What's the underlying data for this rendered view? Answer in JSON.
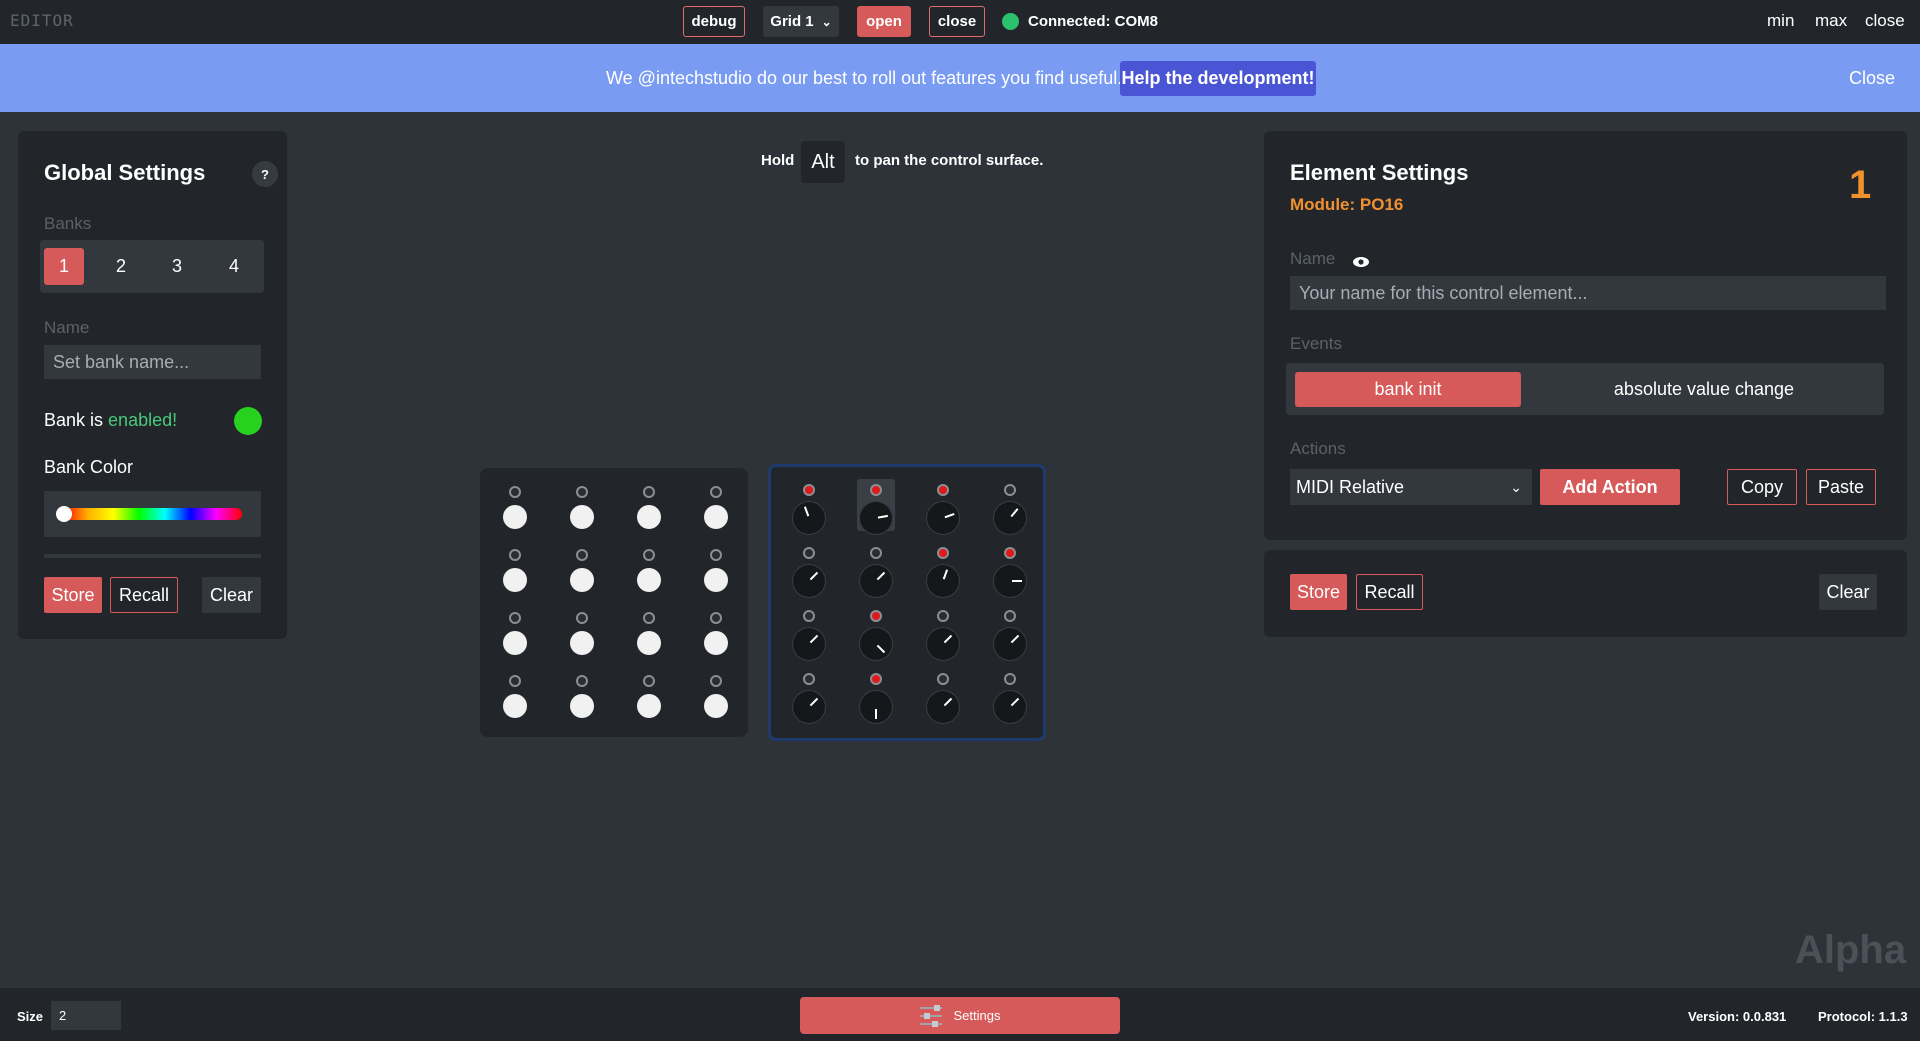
{
  "topbar": {
    "app_title": "EDITOR",
    "debug": "debug",
    "grid_select": "Grid 1",
    "open": "open",
    "close": "close",
    "status": "Connected: COM8",
    "min": "min",
    "max": "max",
    "win_close": "close"
  },
  "banner": {
    "text": "We @intechstudio do our best to roll out features you find useful.",
    "button": "Help the development!",
    "close": "Close"
  },
  "global": {
    "title": "Global Settings",
    "help": "?",
    "banks_label": "Banks",
    "banks": [
      "1",
      "2",
      "3",
      "4"
    ],
    "name_label": "Name",
    "name_placeholder": "Set bank name...",
    "bank_is": "Bank is",
    "enabled": "enabled!",
    "color_label": "Bank Color",
    "store": "Store",
    "recall": "Recall",
    "clear": "Clear"
  },
  "hint": {
    "hold": "Hold",
    "key": "Alt",
    "rest": "to pan the control surface."
  },
  "element": {
    "title": "Element Settings",
    "number": "1",
    "module": "Module: PO16",
    "name_label": "Name",
    "name_placeholder": "Your name for this control element...",
    "events_label": "Events",
    "events": [
      "bank init",
      "absolute value change"
    ],
    "actions_label": "Actions",
    "action_select": "MIDI Relative",
    "add_action": "Add Action",
    "copy": "Copy",
    "paste": "Paste",
    "store": "Store",
    "recall": "Recall",
    "clear": "Clear"
  },
  "watermark": "Alpha",
  "bottombar": {
    "size_label": "Size",
    "size_value": "2",
    "settings": "Settings",
    "version": "Version: 0.0.831",
    "protocol": "Protocol: 1.1.3"
  },
  "modules": {
    "left_leds_on": [],
    "right_leds_on": [
      0,
      1,
      2,
      6,
      7,
      9,
      13
    ],
    "right_knob_angles": [
      -20,
      80,
      70,
      40,
      45,
      45,
      20,
      90,
      45,
      135,
      45,
      45,
      45,
      180,
      45,
      45
    ]
  }
}
